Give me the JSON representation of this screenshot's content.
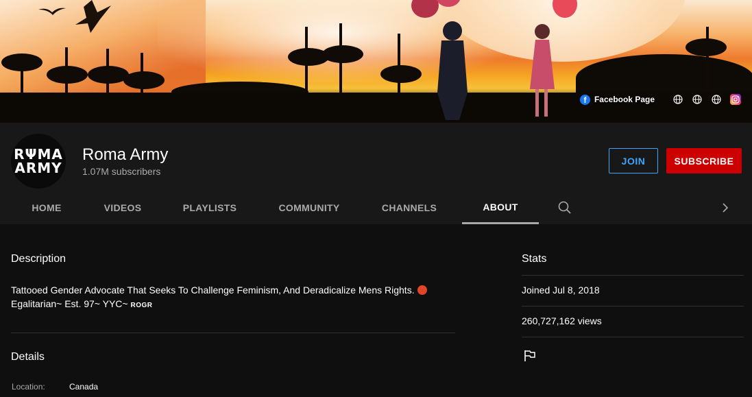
{
  "banner": {
    "links": {
      "facebook_label": "Facebook Page",
      "icons": [
        "facebook-icon",
        "globe-icon",
        "globe-icon",
        "globe-icon",
        "instagram-icon"
      ]
    }
  },
  "channel": {
    "avatar_text_line1": "RΨMA",
    "avatar_text_line2": "ARMY",
    "name": "Roma Army",
    "subscribers": "1.07M subscribers",
    "join_label": "JOIN",
    "subscribe_label": "SUBSCRIBE"
  },
  "tabs": [
    {
      "label": "HOME",
      "active": false
    },
    {
      "label": "VIDEOS",
      "active": false
    },
    {
      "label": "PLAYLISTS",
      "active": false
    },
    {
      "label": "COMMUNITY",
      "active": false
    },
    {
      "label": "CHANNELS",
      "active": false
    },
    {
      "label": "ABOUT",
      "active": true
    }
  ],
  "about": {
    "description_heading": "Description",
    "description_line1": "Tattooed Gender Advocate That Seeks To Challenge Feminism, And Deradicalize Mens Rights.",
    "description_line2": "Egalitarian~ Est. 97~ YYC~",
    "description_smallcaps": "ROGR",
    "details_heading": "Details",
    "location_label": "Location:",
    "location_value": "Canada"
  },
  "stats": {
    "heading": "Stats",
    "joined": "Joined Jul 8, 2018",
    "views": "260,727,162 views"
  },
  "colors": {
    "accent_blue": "#3ea6ff",
    "subscribe_red": "#cc0000",
    "page_bg": "#0f0f0f",
    "header_bg": "#181818"
  }
}
